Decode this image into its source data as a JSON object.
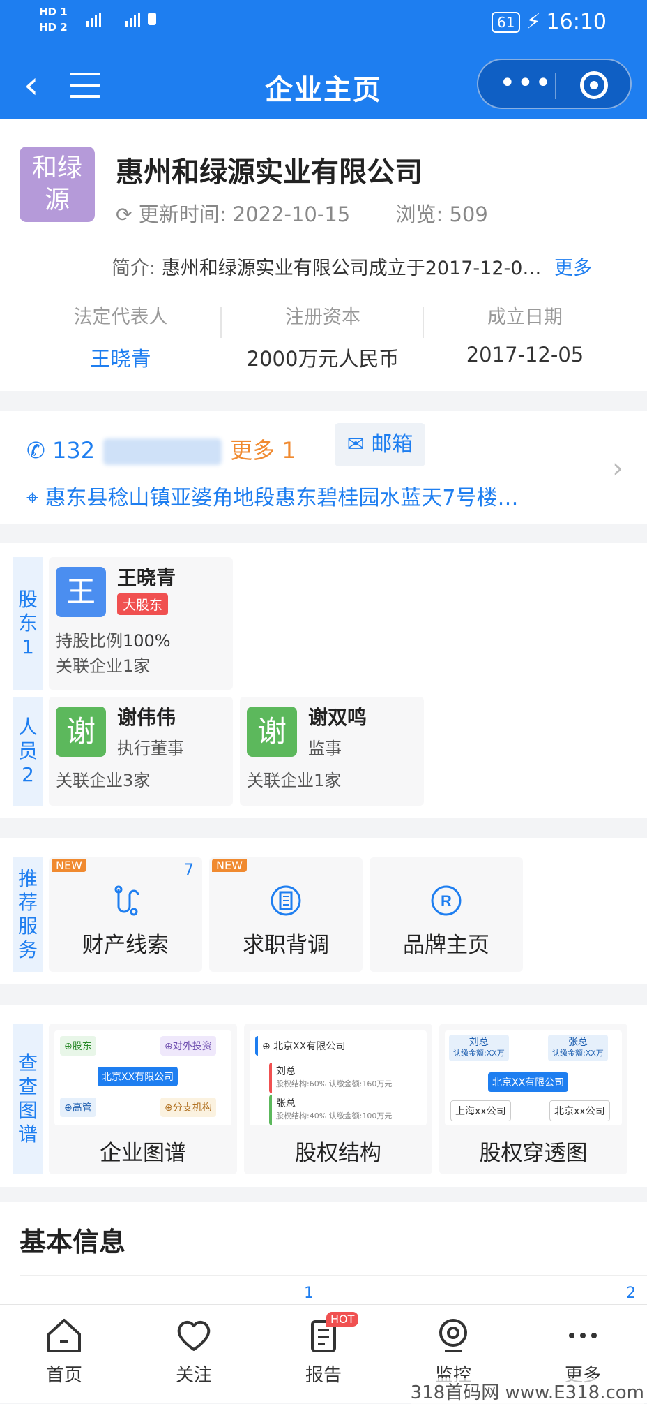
{
  "status": {
    "hd1": "HD 1",
    "hd2": "HD 2",
    "sig": "4G 4G",
    "battery": "61",
    "time": "16:10"
  },
  "nav": {
    "title": "企业主页"
  },
  "company": {
    "logo_text": "和绿源",
    "name": "惠州和绿源实业有限公司",
    "update_label": "更新时间:",
    "update_date": "2022-10-15",
    "views_label": "浏览:",
    "views": "509",
    "intro_label": "简介:",
    "intro": "惠州和绿源实业有限公司成立于2017-12-0…",
    "intro_more": "更多"
  },
  "facts": [
    {
      "k": "法定代表人",
      "v": "王晓青"
    },
    {
      "k": "注册资本",
      "v": "2000万元人民币"
    },
    {
      "k": "成立日期",
      "v": "2017-12-05"
    }
  ],
  "contact": {
    "phone": "132",
    "more": "更多 1",
    "mail": "邮箱",
    "address": "惠东县稔山镇亚婆角地段惠东碧桂园水蓝天7号楼…"
  },
  "shareholders": {
    "label": "股东1",
    "name": "王晓青",
    "avatar": "王",
    "tag": "大股东",
    "ratio_label": "持股比例",
    "ratio": "100%",
    "related": "关联企业1家"
  },
  "staff": {
    "label": "人员2",
    "people": [
      {
        "avatar": "谢",
        "name": "谢伟伟",
        "role": "执行董事",
        "related": "关联企业3家"
      },
      {
        "avatar": "谢",
        "name": "谢双鸣",
        "role": "监事",
        "related": "关联企业1家"
      }
    ]
  },
  "services": {
    "label": "推荐服务",
    "badge_count": "7",
    "items": [
      {
        "label": "财产线索",
        "new": "NEW"
      },
      {
        "label": "求职背调",
        "new": "NEW"
      },
      {
        "label": "品牌主页"
      }
    ]
  },
  "graphs": {
    "label": "查查图谱",
    "items": [
      {
        "label": "企业图谱"
      },
      {
        "label": "股权结构"
      },
      {
        "label": "股权穿透图"
      }
    ],
    "g1": {
      "a": "⊕股东",
      "b": "⊕对外投资",
      "c": "北京XX有限公司",
      "d": "⊕高管",
      "e": "⊕分支机构"
    },
    "g2": {
      "a": "⊕ 北京XX有限公司",
      "b": "刘总",
      "b2": "股权结构:60% 认缴金额:160万元",
      "c": "张总",
      "c2": "股权结构:40% 认缴金额:100万元"
    },
    "g3": {
      "a": "刘总",
      "a2": "认缴金额:XX万",
      "b": "张总",
      "b2": "认缴金额:XX万",
      "c": "北京XX有限公司",
      "d": "上海xx公司",
      "e": "北京xx公司"
    }
  },
  "basic": {
    "title": "基本信息",
    "n1": "1",
    "n2": "2"
  },
  "tabs": [
    {
      "label": "首页"
    },
    {
      "label": "关注"
    },
    {
      "label": "报告",
      "hot": "HOT"
    },
    {
      "label": "监控"
    },
    {
      "label": "更多"
    }
  ],
  "watermark": "318首码网 www.E318.com",
  "colors": {
    "brand": "#1e7ef0",
    "accent": "#f08a30",
    "tag": "#f05050"
  }
}
